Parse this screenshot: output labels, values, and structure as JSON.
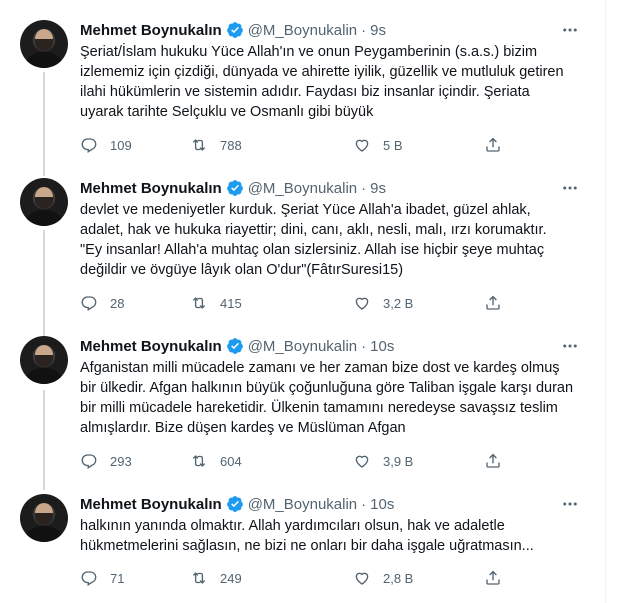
{
  "tweets": [
    {
      "name": "Mehmet Boynukalın",
      "handle": "@M_Boynukalin",
      "separator": "·",
      "time": "9s",
      "lines": [
        "Şeriat/İslam hukuku Yüce Allah'ın ve onun Peygamberinin (s.a.s.) bizim",
        "izlememiz için çizdiği, dünyada ve ahirette iyilik, güzellik ve mutluluk getiren",
        "ilahi hükümlerin ve sistemin adıdır. Faydası biz insanlar içindir. Şeriata",
        "uyarak tarihte Selçuklu ve Osmanlı gibi büyük"
      ],
      "replies": "109",
      "retweets": "788",
      "likes": "5 B"
    },
    {
      "name": "Mehmet Boynukalın",
      "handle": "@M_Boynukalin",
      "separator": "·",
      "time": "9s",
      "lines": [
        "devlet ve medeniyetler kurduk. Şeriat Yüce Allah'a ibadet, güzel ahlak,",
        "adalet, hak ve hukuka riayettir; dini, canı, aklı, nesli, malı, ırzı korumaktır.",
        "\"Ey insanlar! Allah'a muhtaç olan sizlersiniz. Allah ise hiçbir şeye muhtaç",
        "değildir ve övgüye lâyık olan O'dur\"(FâtırSuresi15)"
      ],
      "replies": "28",
      "retweets": "415",
      "likes": "3,2 B"
    },
    {
      "name": "Mehmet Boynukalın",
      "handle": "@M_Boynukalin",
      "separator": "·",
      "time": "10s",
      "lines": [
        "Afganistan milli mücadele zamanı ve her zaman bize dost ve kardeş olmuş",
        "bir ülkedir. Afgan halkının büyük çoğunluğuna göre Taliban işgale karşı duran",
        "bir milli mücadele hareketidir. Ülkenin tamamını neredeyse savaşsız teslim",
        "almışlardır. Bize düşen kardeş ve Müslüman Afgan"
      ],
      "replies": "293",
      "retweets": "604",
      "likes": "3,9 B"
    },
    {
      "name": "Mehmet Boynukalın",
      "handle": "@M_Boynukalin",
      "separator": "·",
      "time": "10s",
      "lines": [
        "halkının yanında  olmaktır. Allah yardımcıları olsun, hak ve adaletle",
        "hükmetmelerini sağlasın, ne bizi ne onları bir daha işgale uğratmasın..."
      ],
      "replies": "71",
      "retweets": "249",
      "likes": "2,8 B"
    }
  ],
  "icons": {
    "more": "more-icon",
    "reply": "reply-icon",
    "retweet": "retweet-icon",
    "like": "heart-icon",
    "share": "share-icon",
    "verified": "verified-badge-icon"
  },
  "colors": {
    "verified": "#1d9bf0",
    "muted": "#536471",
    "text": "#0f1419",
    "thread": "#cfd9de"
  }
}
